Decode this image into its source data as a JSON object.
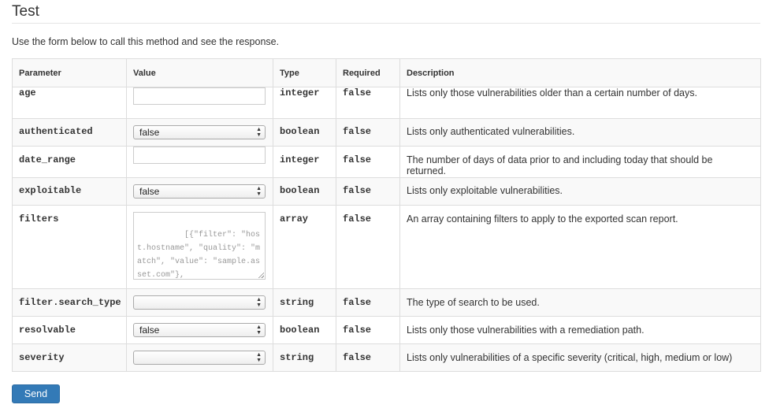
{
  "page": {
    "title": "Test",
    "intro": "Use the form below to call this method and see the response."
  },
  "table": {
    "headers": {
      "parameter": "Parameter",
      "value": "Value",
      "type": "Type",
      "required": "Required",
      "description": "Description"
    },
    "rows": [
      {
        "name": "age",
        "input_kind": "text",
        "value": "",
        "type": "integer",
        "required": "false",
        "description": "Lists only those vulnerabilities older than a certain number of days."
      },
      {
        "name": "authenticated",
        "input_kind": "select",
        "value": "false",
        "type": "boolean",
        "required": "false",
        "description": "Lists only authenticated vulnerabilities."
      },
      {
        "name": "date_range",
        "input_kind": "text",
        "value": "",
        "type": "integer",
        "required": "false",
        "description": "The number of days of data prior to and including today that should be returned."
      },
      {
        "name": "exploitable",
        "input_kind": "select",
        "value": "false",
        "type": "boolean",
        "required": "false",
        "description": "Lists only exploitable vulnerabilities."
      },
      {
        "name": "filters",
        "input_kind": "textarea",
        "placeholder": "[{\"filter\": \"host.hostname\", \"quality\": \"match\", \"value\": \"sample.asset.com\"},",
        "type": "array",
        "required": "false",
        "description": "An array containing filters to apply to the exported scan report."
      },
      {
        "name": "filter.search_type",
        "input_kind": "select",
        "value": "",
        "type": "string",
        "required": "false",
        "description": "The type of search to be used."
      },
      {
        "name": "resolvable",
        "input_kind": "select",
        "value": "false",
        "type": "boolean",
        "required": "false",
        "description": "Lists only those vulnerabilities with a remediation path."
      },
      {
        "name": "severity",
        "input_kind": "select",
        "value": "",
        "type": "string",
        "required": "false",
        "description": "Lists only vulnerabilities of a specific severity (critical, high, medium or low)"
      }
    ]
  },
  "actions": {
    "send_label": "Send"
  },
  "colors": {
    "button_bg": "#337ab7",
    "border": "#dddddd",
    "stripe": "#f9f9f9"
  }
}
